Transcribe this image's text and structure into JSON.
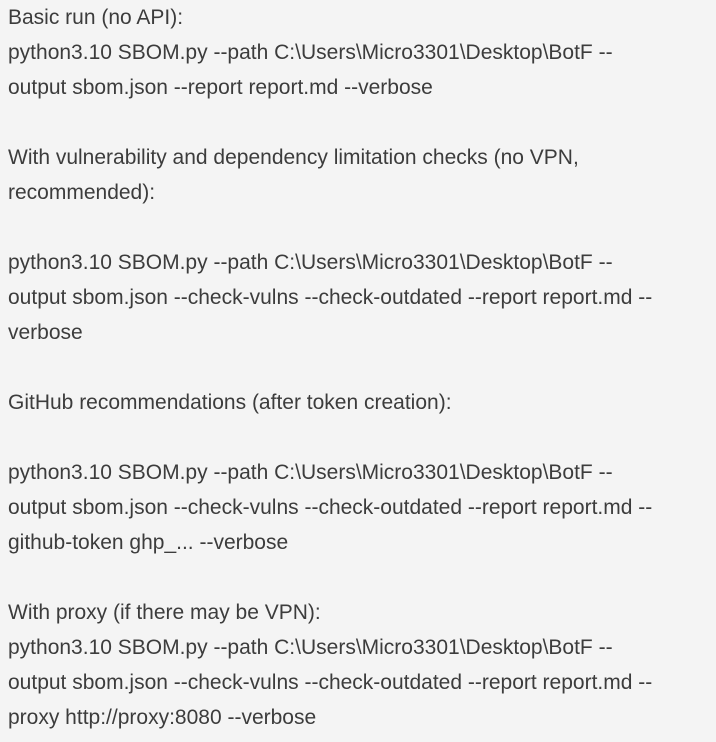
{
  "sections": [
    {
      "title": "Basic run (no API):",
      "command_lines": [
        "python3.10 SBOM.py --path C:\\Users\\Micro3301\\Desktop\\BotF --",
        "output sbom.json --report report.md --verbose"
      ]
    },
    {
      "title_lines": [
        "With vulnerability and dependency limitation checks (no VPN,",
        "recommended):"
      ],
      "command_lines": [
        "python3.10 SBOM.py --path C:\\Users\\Micro3301\\Desktop\\BotF --",
        "output sbom.json --check-vulns --check-outdated --report report.md --",
        "verbose"
      ]
    },
    {
      "title": "GitHub recommendations (after token creation):",
      "command_lines": [
        "python3.10 SBOM.py --path C:\\Users\\Micro3301\\Desktop\\BotF --",
        "output sbom.json --check-vulns --check-outdated --report report.md --",
        "github-token ghp_... --verbose"
      ]
    },
    {
      "title": "With proxy (if there may be VPN):",
      "command_lines": [
        "python3.10 SBOM.py --path C:\\Users\\Micro3301\\Desktop\\BotF --",
        "output sbom.json --check-vulns --check-outdated --report report.md --",
        "proxy http://proxy:8080 --verbose"
      ]
    }
  ]
}
